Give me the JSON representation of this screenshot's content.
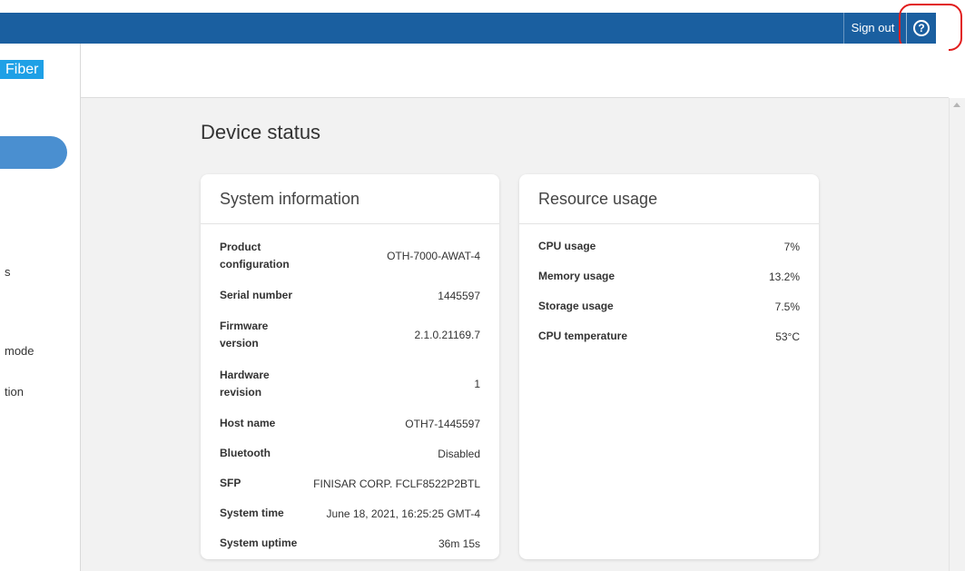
{
  "topbar": {
    "signout_label": "Sign out",
    "help_symbol": "?"
  },
  "brand": {
    "logo_text": "Fiber"
  },
  "sidebar": {
    "items": [
      {
        "label": "s"
      },
      {
        "label": "mode"
      },
      {
        "label": "tion"
      }
    ]
  },
  "page": {
    "title": "Device status"
  },
  "system_info": {
    "title": "System information",
    "rows": [
      {
        "key": "Product configuration",
        "value": "OTH-7000-AWAT-4"
      },
      {
        "key": "Serial number",
        "value": "1445597"
      },
      {
        "key": "Firmware version",
        "value": "2.1.0.21169.7"
      },
      {
        "key": "Hardware revision",
        "value": "1"
      },
      {
        "key": "Host name",
        "value": "OTH7-1445597"
      },
      {
        "key": "Bluetooth",
        "value": "Disabled"
      },
      {
        "key": "SFP",
        "value": "FINISAR CORP. FCLF8522P2BTL"
      },
      {
        "key": "System time",
        "value": "June 18, 2021, 16:25:25 GMT-4"
      },
      {
        "key": "System uptime",
        "value": "36m 15s"
      }
    ]
  },
  "resource_usage": {
    "title": "Resource usage",
    "rows": [
      {
        "key": "CPU usage",
        "value": "7%"
      },
      {
        "key": "Memory usage",
        "value": "13.2%"
      },
      {
        "key": "Storage usage",
        "value": "7.5%"
      },
      {
        "key": "CPU temperature",
        "value": "53°C"
      }
    ]
  },
  "colors": {
    "accent": "#1a5fa0",
    "logo": "#1ea0e6",
    "annotation": "#e11d1d"
  }
}
